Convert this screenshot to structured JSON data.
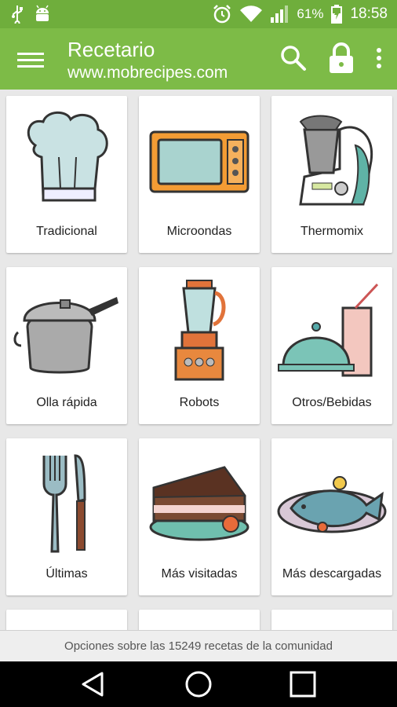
{
  "status_bar": {
    "icons_left": [
      "usb-icon",
      "android-icon"
    ],
    "icons_right": [
      "alarm-icon",
      "wifi-icon",
      "signal-icon",
      "battery-icon"
    ],
    "battery": "61%",
    "time": "18:58"
  },
  "app_bar": {
    "title": "Recetario",
    "subtitle": "www.mobrecipes.com",
    "color": "#7dbb47",
    "actions": [
      "search-icon",
      "lock-icon",
      "more-vert-icon"
    ]
  },
  "categories": [
    {
      "label": "Tradicional",
      "icon": "chef-hat-icon"
    },
    {
      "label": "Microondas",
      "icon": "microwave-icon"
    },
    {
      "label": "Thermomix",
      "icon": "thermomix-icon"
    },
    {
      "label": "Olla rápida",
      "icon": "pressure-cooker-icon"
    },
    {
      "label": "Robots",
      "icon": "blender-robot-icon"
    },
    {
      "label": "Otros/Bebidas",
      "icon": "cloche-drink-icon"
    },
    {
      "label": "Últimas",
      "icon": "fork-knife-icon"
    },
    {
      "label": "Más visitadas",
      "icon": "cake-slice-icon"
    },
    {
      "label": "Más descargadas",
      "icon": "fish-plate-icon"
    }
  ],
  "footer": {
    "text": "Opciones sobre las 15249 recetas de la comunidad"
  },
  "nav_bar": {
    "buttons": [
      "back-icon",
      "home-icon",
      "recents-icon"
    ]
  }
}
